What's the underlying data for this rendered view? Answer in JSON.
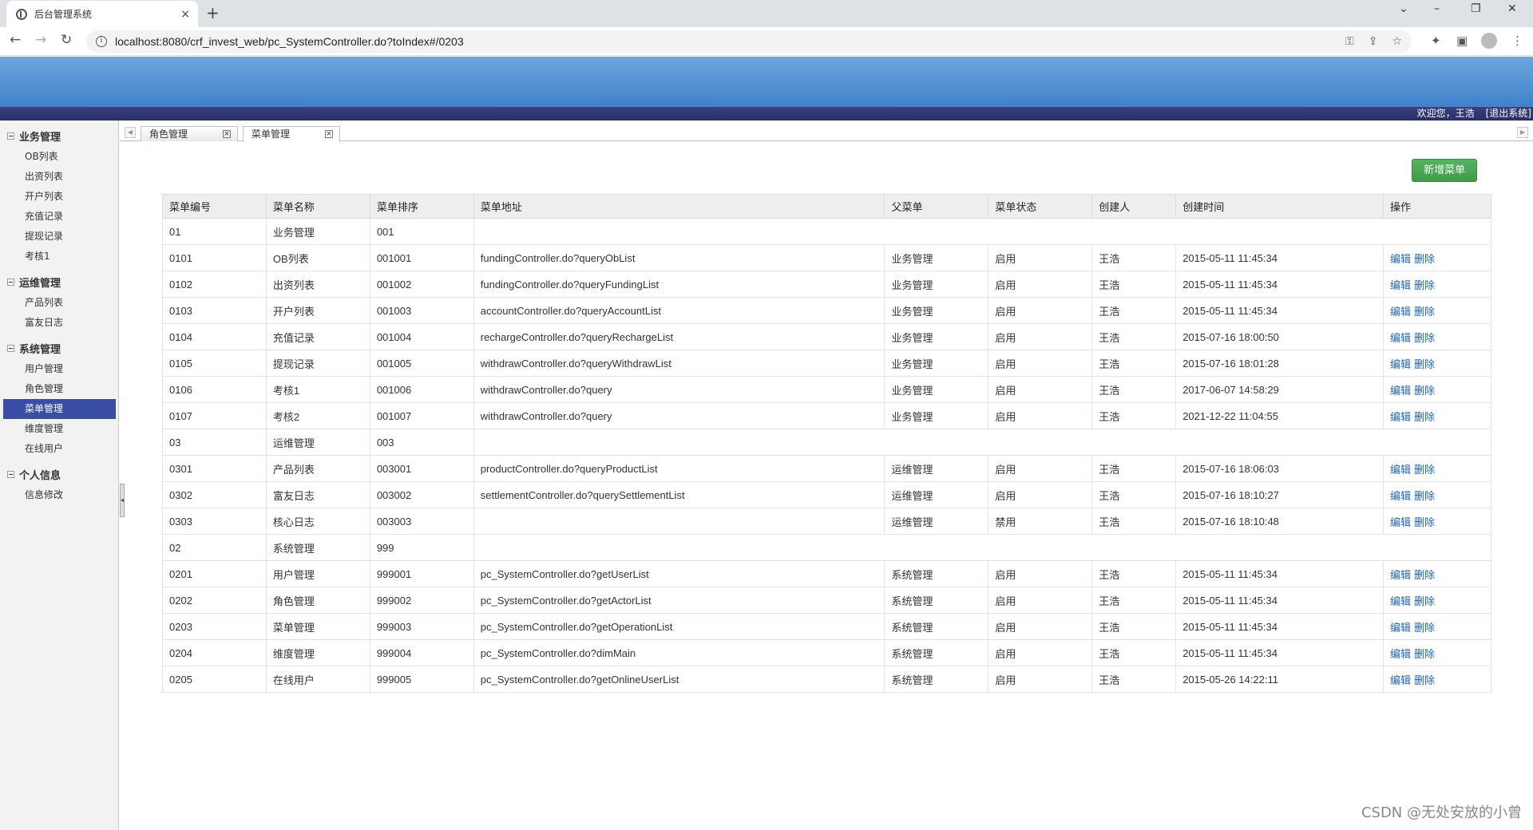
{
  "browser": {
    "tab_title": "后台管理系统",
    "tab_close": "×",
    "new_tab": "+",
    "url": "localhost:8080/crf_invest_web/pc_SystemController.do?toIndex#/0203",
    "controls": {
      "collapse": "⌄",
      "minimize": "–",
      "restore": "❐",
      "close": "✕"
    }
  },
  "header": {
    "welcome": "欢迎您，王浩",
    "logout": "[退出系统]"
  },
  "sidebar": {
    "groups": [
      {
        "title": "业务管理",
        "items": [
          "OB列表",
          "出资列表",
          "开户列表",
          "充值记录",
          "提现记录",
          "考核1"
        ]
      },
      {
        "title": "运维管理",
        "items": [
          "产品列表",
          "富友日志"
        ]
      },
      {
        "title": "系统管理",
        "items": [
          "用户管理",
          "角色管理",
          "菜单管理",
          "维度管理",
          "在线用户"
        ]
      },
      {
        "title": "个人信息",
        "items": [
          "信息修改"
        ]
      }
    ],
    "active_item": "菜单管理"
  },
  "content_tabs": [
    {
      "label": "角色管理",
      "active": false
    },
    {
      "label": "菜单管理",
      "active": true
    }
  ],
  "main": {
    "add_button": "新增菜单",
    "columns": [
      "菜单编号",
      "菜单名称",
      "菜单排序",
      "菜单地址",
      "父菜单",
      "菜单状态",
      "创建人",
      "创建时间",
      "操作"
    ],
    "edit_label": "编辑",
    "delete_label": "删除",
    "rows": [
      {
        "id": "01",
        "name": "业务管理",
        "order": "001",
        "top": true
      },
      {
        "id": "0101",
        "name": "OB列表",
        "order": "001001",
        "url": "fundingController.do?queryObList",
        "parent": "业务管理",
        "status": "启用",
        "creator": "王浩",
        "created": "2015-05-11 11:45:34"
      },
      {
        "id": "0102",
        "name": "出资列表",
        "order": "001002",
        "url": "fundingController.do?queryFundingList",
        "parent": "业务管理",
        "status": "启用",
        "creator": "王浩",
        "created": "2015-05-11 11:45:34"
      },
      {
        "id": "0103",
        "name": "开户列表",
        "order": "001003",
        "url": "accountController.do?queryAccountList",
        "parent": "业务管理",
        "status": "启用",
        "creator": "王浩",
        "created": "2015-05-11 11:45:34"
      },
      {
        "id": "0104",
        "name": "充值记录",
        "order": "001004",
        "url": "rechargeController.do?queryRechargeList",
        "parent": "业务管理",
        "status": "启用",
        "creator": "王浩",
        "created": "2015-07-16 18:00:50"
      },
      {
        "id": "0105",
        "name": "提现记录",
        "order": "001005",
        "url": "withdrawController.do?queryWithdrawList",
        "parent": "业务管理",
        "status": "启用",
        "creator": "王浩",
        "created": "2015-07-16 18:01:28"
      },
      {
        "id": "0106",
        "name": "考核1",
        "order": "001006",
        "url": "withdrawController.do?query",
        "parent": "业务管理",
        "status": "启用",
        "creator": "王浩",
        "created": "2017-06-07 14:58:29"
      },
      {
        "id": "0107",
        "name": "考核2",
        "order": "001007",
        "url": "withdrawController.do?query",
        "parent": "业务管理",
        "status": "启用",
        "creator": "王浩",
        "created": "2021-12-22 11:04:55"
      },
      {
        "id": "03",
        "name": "运维管理",
        "order": "003",
        "top": true
      },
      {
        "id": "0301",
        "name": "产品列表",
        "order": "003001",
        "url": "productController.do?queryProductList",
        "parent": "运维管理",
        "status": "启用",
        "creator": "王浩",
        "created": "2015-07-16 18:06:03"
      },
      {
        "id": "0302",
        "name": "富友日志",
        "order": "003002",
        "url": "settlementController.do?querySettlementList",
        "parent": "运维管理",
        "status": "启用",
        "creator": "王浩",
        "created": "2015-07-16 18:10:27"
      },
      {
        "id": "0303",
        "name": "核心日志",
        "order": "003003",
        "url": "",
        "parent": "运维管理",
        "status": "禁用",
        "creator": "王浩",
        "created": "2015-07-16 18:10:48"
      },
      {
        "id": "02",
        "name": "系统管理",
        "order": "999",
        "top": true
      },
      {
        "id": "0201",
        "name": "用户管理",
        "order": "999001",
        "url": "pc_SystemController.do?getUserList",
        "parent": "系统管理",
        "status": "启用",
        "creator": "王浩",
        "created": "2015-05-11 11:45:34"
      },
      {
        "id": "0202",
        "name": "角色管理",
        "order": "999002",
        "url": "pc_SystemController.do?getActorList",
        "parent": "系统管理",
        "status": "启用",
        "creator": "王浩",
        "created": "2015-05-11 11:45:34"
      },
      {
        "id": "0203",
        "name": "菜单管理",
        "order": "999003",
        "url": "pc_SystemController.do?getOperationList",
        "parent": "系统管理",
        "status": "启用",
        "creator": "王浩",
        "created": "2015-05-11 11:45:34"
      },
      {
        "id": "0204",
        "name": "维度管理",
        "order": "999004",
        "url": "pc_SystemController.do?dimMain",
        "parent": "系统管理",
        "status": "启用",
        "creator": "王浩",
        "created": "2015-05-11 11:45:34"
      },
      {
        "id": "0205",
        "name": "在线用户",
        "order": "999005",
        "url": "pc_SystemController.do?getOnlineUserList",
        "parent": "系统管理",
        "status": "启用",
        "creator": "王浩",
        "created": "2015-05-26 14:22:11"
      }
    ]
  },
  "watermark": "CSDN @无处安放的小曾",
  "colors": {
    "header_top": "#6ea4de",
    "header_bottom": "#3f82ca",
    "strip": "#283066",
    "active_item": "#3b4ea6",
    "add_button": "#4aa853",
    "link": "#1a66c8"
  }
}
